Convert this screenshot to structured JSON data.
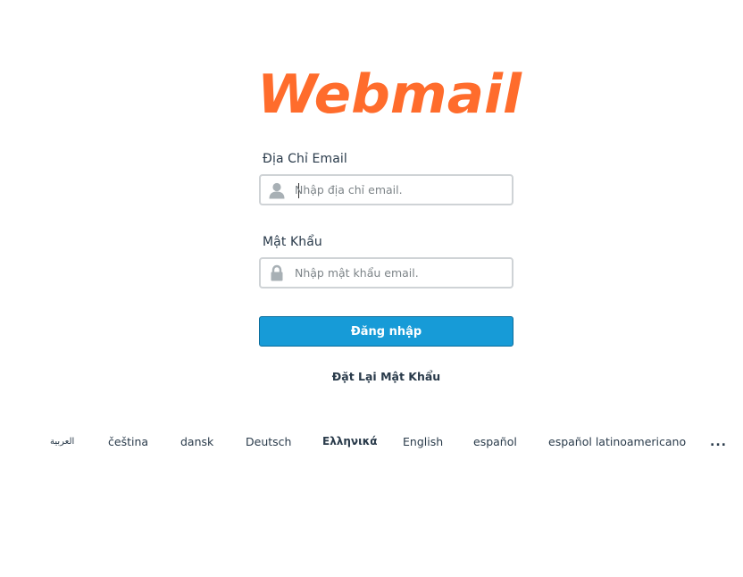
{
  "brand": {
    "logo_text": "Webmail",
    "logo_color": "#ff6c2c"
  },
  "login_form": {
    "email_label": "Địa Chỉ Email",
    "email_placeholder": "Nhập địa chỉ email.",
    "email_icon": "user-icon",
    "password_label": "Mật Khẩu",
    "password_placeholder": "Nhập mật khẩu email.",
    "password_icon": "lock-icon",
    "submit_label": "Đăng nhập",
    "submit_color": "#179bd7",
    "reset_label": "Đặt Lại Mật Khẩu"
  },
  "locales": {
    "items": [
      "العربية",
      "čeština",
      "dansk",
      "Deutsch",
      "Ελληνικά",
      "English",
      "español",
      "español latinoamericano"
    ],
    "more_label": "..."
  }
}
